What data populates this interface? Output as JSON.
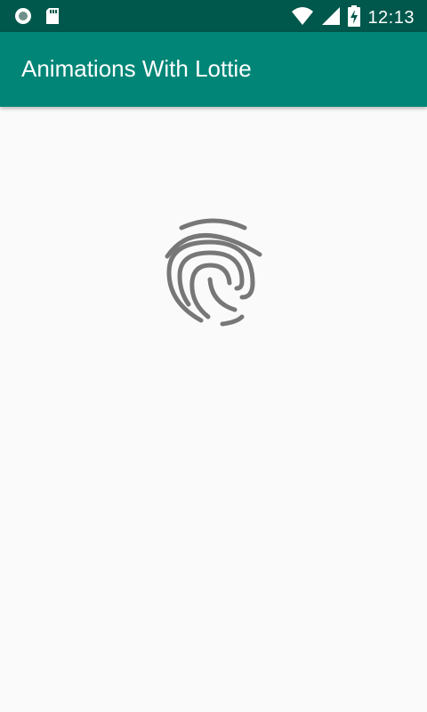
{
  "status_bar": {
    "time": "12:13",
    "icons": [
      "notification-circle-icon",
      "sd-card-icon",
      "wifi-icon",
      "cell-signal-icon",
      "battery-charging-icon"
    ]
  },
  "app_bar": {
    "title": "Animations With Lottie"
  },
  "content": {
    "animation_icon": "fingerprint-icon"
  },
  "colors": {
    "status_bar": "#00574b",
    "app_bar": "#008577",
    "background": "#fafafa",
    "icon_gray": "#777777"
  }
}
